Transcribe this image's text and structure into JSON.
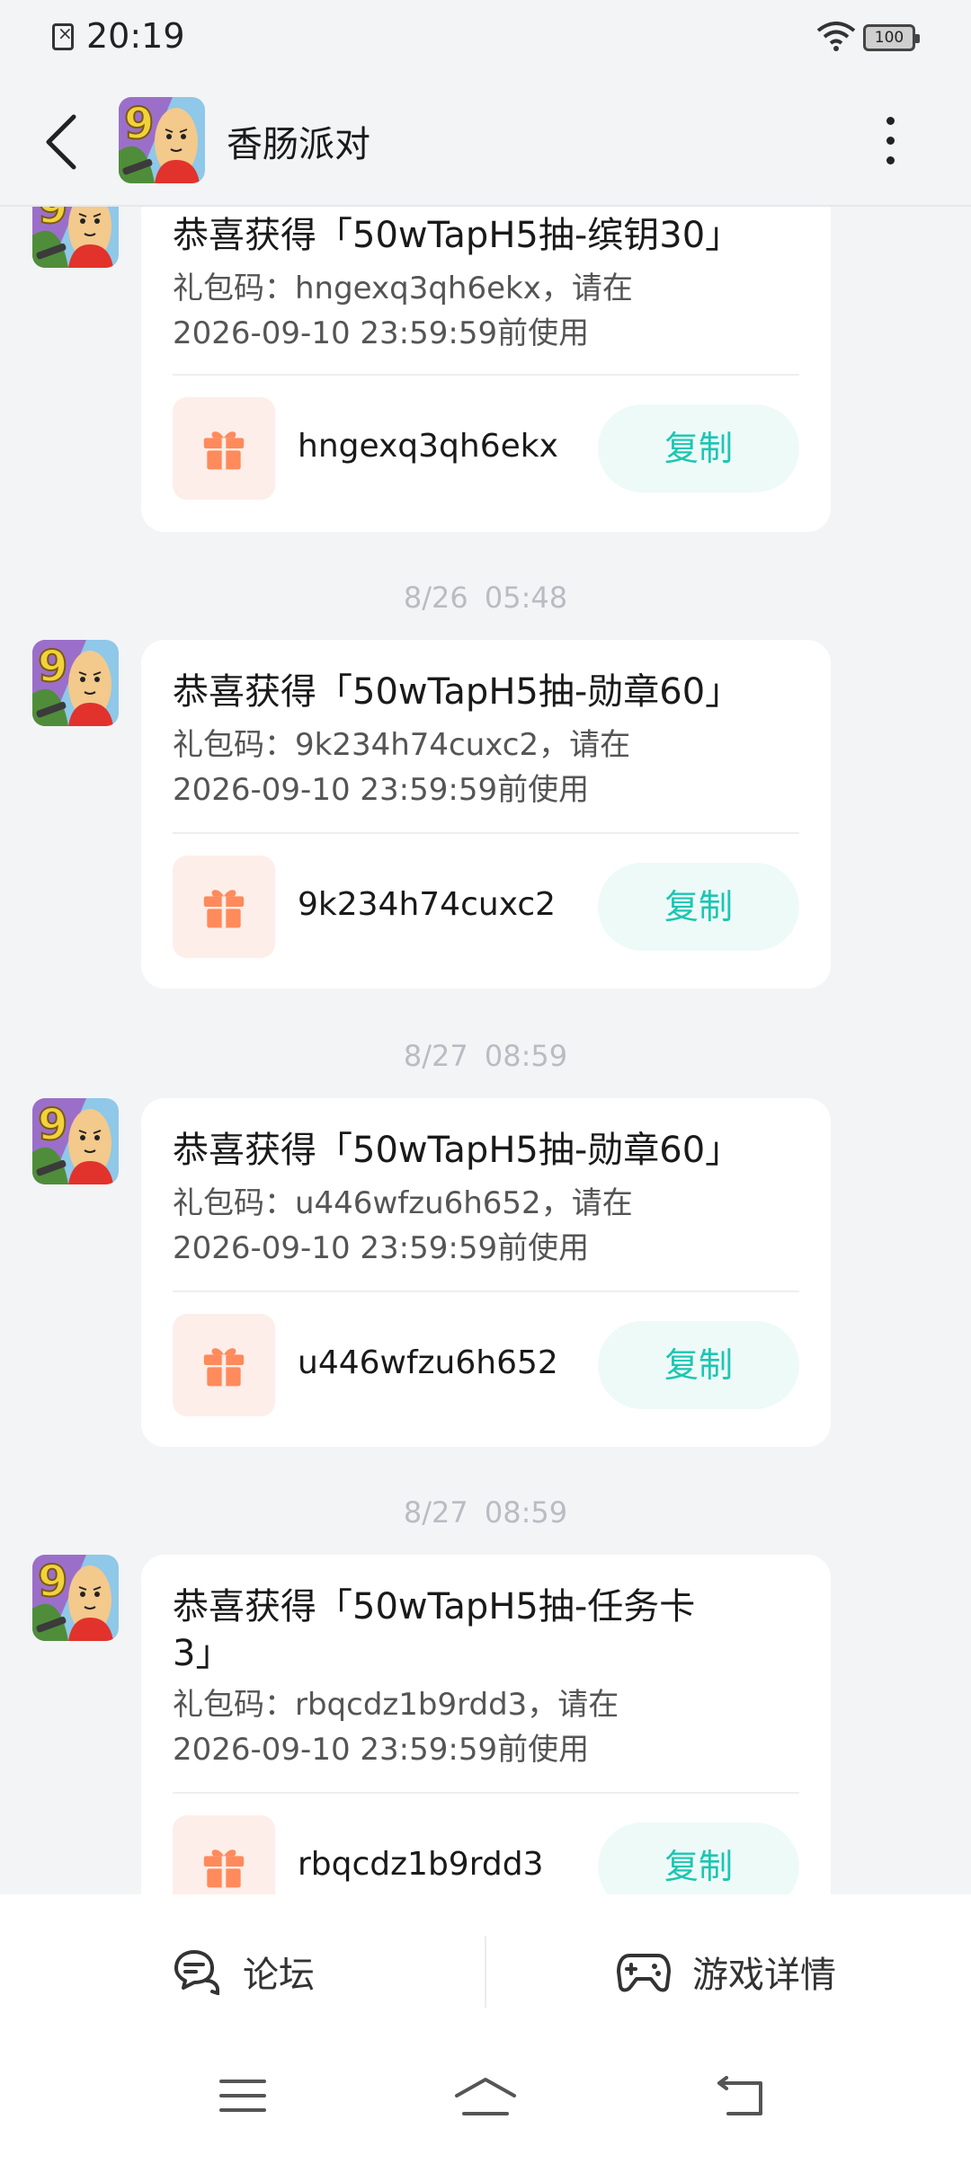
{
  "status_bar": {
    "time": "20:19",
    "battery": "100"
  },
  "header": {
    "title": "香肠派对"
  },
  "messages": [
    {
      "timestamp": "",
      "title": "恭喜获得「50wTapH5抽-缤钥30」",
      "desc_line1": "礼包码：hngexq3qh6ekx，请在",
      "desc_line2": "2026-09-10 23:59:59前使用",
      "code": "hngexq3qh6ekx",
      "copy_label": "复制"
    },
    {
      "timestamp": "8/26  05:48",
      "title": "恭喜获得「50wTapH5抽-勋章60」",
      "desc_line1": "礼包码：9k234h74cuxc2，请在",
      "desc_line2": "2026-09-10 23:59:59前使用",
      "code": "9k234h74cuxc2",
      "copy_label": "复制"
    },
    {
      "timestamp": "8/27  08:59",
      "title": "恭喜获得「50wTapH5抽-勋章60」",
      "desc_line1": "礼包码：u446wfzu6h652，请在",
      "desc_line2": "2026-09-10 23:59:59前使用",
      "code": "u446wfzu6h652",
      "copy_label": "复制"
    },
    {
      "timestamp": "8/27  08:59",
      "title_line1": "恭喜获得「50wTapH5抽-任务卡",
      "title_line2": "3」",
      "desc_line1": "礼包码：rbqcdz1b9rdd3，请在",
      "desc_line2": "2026-09-10 23:59:59前使用",
      "code": "rbqcdz1b9rdd3",
      "copy_label": "复制"
    }
  ],
  "tabbar": {
    "forum_label": "论坛",
    "game_label": "游戏详情"
  },
  "colors": {
    "accent": "#1cc6b2",
    "gift": "#ff8a5c",
    "background": "#f3f4f6"
  },
  "icons": [
    "back-arrow-icon",
    "more-vertical-icon",
    "gift-icon",
    "forum-chat-icon",
    "gamepad-icon",
    "menu-icon",
    "home-icon",
    "return-icon"
  ]
}
